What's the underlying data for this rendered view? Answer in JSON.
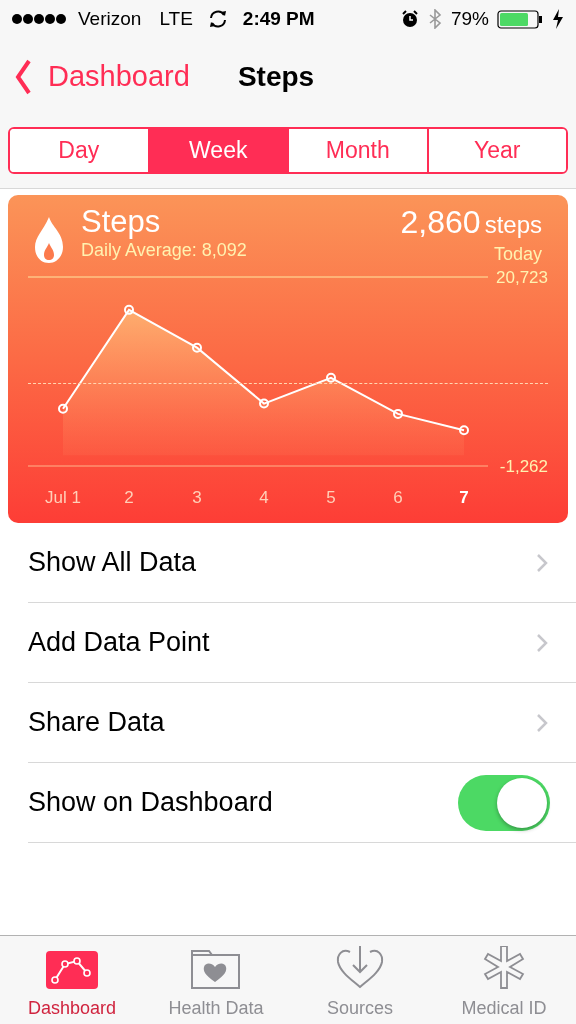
{
  "status_bar": {
    "carrier": "Verizon",
    "network": "LTE",
    "time": "2:49 PM",
    "battery": "79%"
  },
  "nav": {
    "back": "Dashboard",
    "title": "Steps"
  },
  "segments": [
    {
      "label": "Day",
      "selected": false
    },
    {
      "label": "Week",
      "selected": true
    },
    {
      "label": "Month",
      "selected": false
    },
    {
      "label": "Year",
      "selected": false
    }
  ],
  "card": {
    "subtitle": "Daily Average: 8,092",
    "value": "2,860",
    "unit": "steps",
    "period": "Today",
    "chart_data": {
      "type": "area",
      "categories": [
        "Jul 1",
        "2",
        "3",
        "4",
        "5",
        "6",
        "7"
      ],
      "ylim": [
        -1262,
        20723
      ],
      "yticks": [
        {
          "value": 20723,
          "label": "20,723"
        },
        {
          "value": -1262,
          "label": "-1,262"
        }
      ],
      "series": [
        {
          "name": "Steps",
          "color": "#ffffff",
          "values": [
            5400,
            16900,
            12500,
            6000,
            9000,
            4800,
            2900
          ]
        }
      ]
    }
  },
  "rows": [
    {
      "kind": "link",
      "label": "Show All Data"
    },
    {
      "kind": "link",
      "label": "Add Data Point"
    },
    {
      "kind": "link",
      "label": "Share Data"
    },
    {
      "kind": "toggle",
      "label": "Show on Dashboard",
      "on": true
    }
  ],
  "tab_bar": [
    {
      "kind": "dashboard",
      "label": "Dashboard",
      "selected": true
    },
    {
      "kind": "health",
      "label": "Health Data",
      "selected": false
    },
    {
      "kind": "sources",
      "label": "Sources",
      "selected": false
    },
    {
      "kind": "medical",
      "label": "Medical ID",
      "selected": false
    }
  ]
}
